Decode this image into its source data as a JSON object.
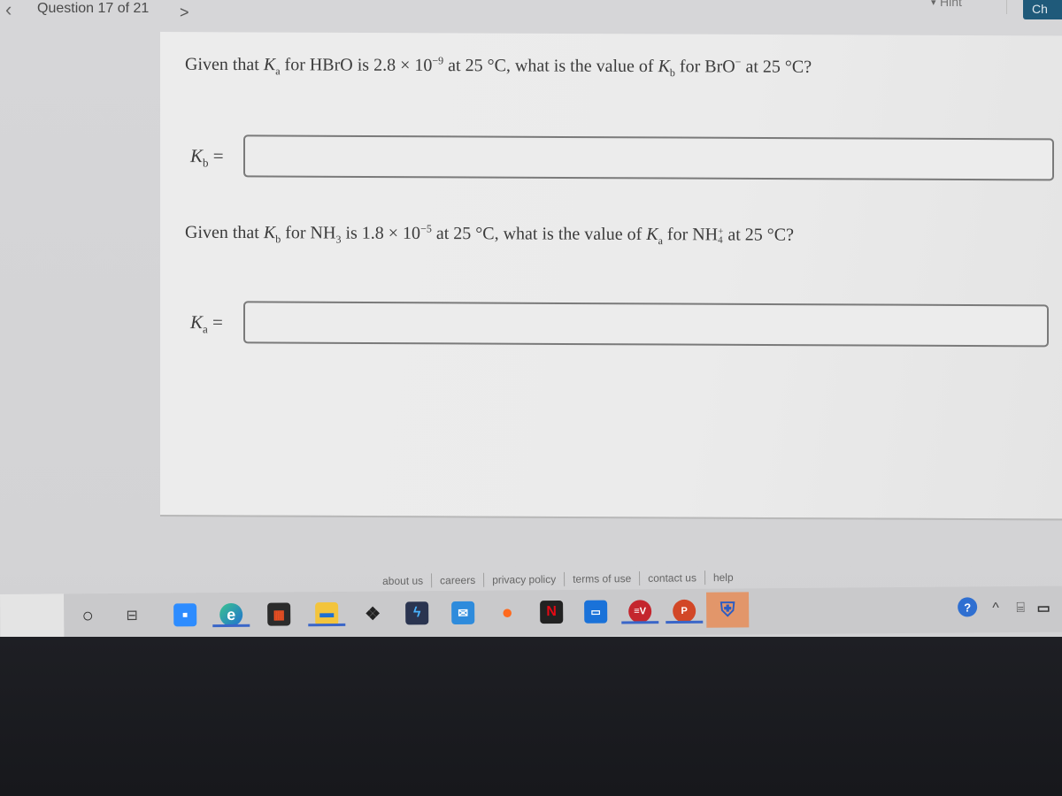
{
  "topbar": {
    "prev_icon": "chevron-left-icon",
    "prev_glyph": "‹",
    "counter": "Question 17 of 21",
    "next_icon": "chevron-right-icon",
    "next_glyph": ">",
    "hint_label": "Hint",
    "hint_icon": "lightbulb-icon",
    "check_label": "Ch"
  },
  "questions": [
    {
      "text": {
        "p1": "Given that ",
        "k1": "K",
        "k1_sub": "a",
        "p2": " for HBrO is 2.8 × 10",
        "exp": "−9",
        "p3": " at 25 °C, what is the value of ",
        "k2": "K",
        "k2_sub": "b",
        "p4": " for BrO",
        "ion_sup": "−",
        "p5": " at 25 °C?"
      },
      "answer_label": {
        "k": "K",
        "sub": "b",
        "eq": " ="
      },
      "answer_value": "",
      "answer_placeholder": ""
    },
    {
      "text": {
        "p1": "Given that ",
        "k1": "K",
        "k1_sub": "b",
        "p2": " for NH",
        "nh_sub": "3",
        "p3": " is 1.8 × 10",
        "exp": "−5",
        "p4": " at 25 °C, what is the value of ",
        "k2": "K",
        "k2_sub": "a",
        "p5": " for NH",
        "ion_sup": "+",
        "ion_sub": "4",
        "p6": " at 25 °C?"
      },
      "answer_label": {
        "k": "K",
        "sub": "a",
        "eq": " ="
      },
      "answer_value": "",
      "answer_placeholder": ""
    }
  ],
  "footer": {
    "links": [
      "about us",
      "careers",
      "privacy policy",
      "terms of use",
      "contact us",
      "help"
    ]
  },
  "taskbar": {
    "apps": [
      {
        "name": "cortana-search",
        "glyph": "○"
      },
      {
        "name": "task-view",
        "glyph": "⊟"
      },
      {
        "name": "zoom",
        "glyph": "■"
      },
      {
        "name": "edge",
        "glyph": "e"
      },
      {
        "name": "microsoft-store",
        "glyph": "▦"
      },
      {
        "name": "file-explorer",
        "glyph": "▬"
      },
      {
        "name": "dropbox",
        "glyph": "❖"
      },
      {
        "name": "app-blue-bolt",
        "glyph": "ϟ"
      },
      {
        "name": "mail",
        "glyph": "✉"
      },
      {
        "name": "firefox",
        "glyph": "●"
      },
      {
        "name": "netflix",
        "glyph": "N"
      },
      {
        "name": "prime-video",
        "glyph": "▭"
      },
      {
        "name": "expressvpn",
        "glyph": "≡V"
      },
      {
        "name": "powerpoint",
        "glyph": "P"
      },
      {
        "name": "security-shield",
        "glyph": "⛨"
      }
    ],
    "tray": [
      {
        "name": "help-tray",
        "glyph": "?"
      },
      {
        "name": "show-hidden-icons",
        "glyph": "^"
      },
      {
        "name": "tablet-mode",
        "glyph": "⌸"
      },
      {
        "name": "battery",
        "glyph": "▭"
      }
    ]
  },
  "colors": {
    "check_button": "#1f5a7a",
    "taskbar_active": "#3a66c8",
    "card_bg": "#ececec",
    "input_border": "#7a7a7a"
  }
}
